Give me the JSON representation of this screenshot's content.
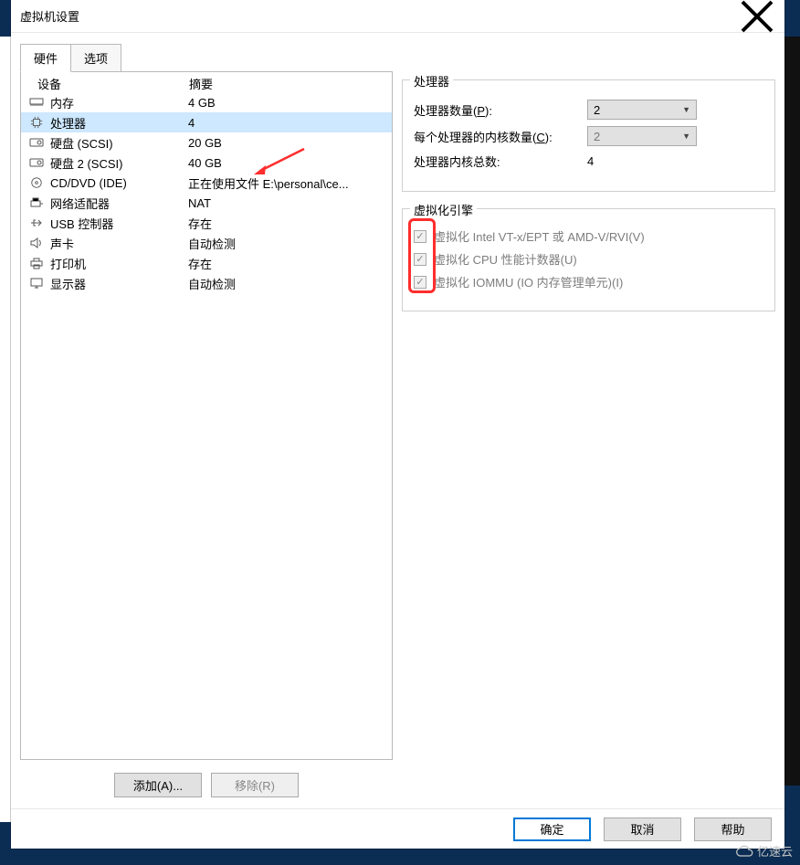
{
  "window": {
    "title": "虚拟机设置"
  },
  "tabs": {
    "hardware": "硬件",
    "options": "选项"
  },
  "device_list": {
    "col_device": "设备",
    "col_summary": "摘要",
    "rows": [
      {
        "name": "内存",
        "summary": "4 GB",
        "icon": "memory"
      },
      {
        "name": "处理器",
        "summary": "4",
        "icon": "cpu",
        "selected": true
      },
      {
        "name": "硬盘 (SCSI)",
        "summary": "20 GB",
        "icon": "disk"
      },
      {
        "name": "硬盘 2 (SCSI)",
        "summary": "40 GB",
        "icon": "disk"
      },
      {
        "name": "CD/DVD (IDE)",
        "summary": "正在使用文件 E:\\personal\\ce...",
        "icon": "cd"
      },
      {
        "name": "网络适配器",
        "summary": "NAT",
        "icon": "net"
      },
      {
        "name": "USB 控制器",
        "summary": "存在",
        "icon": "usb"
      },
      {
        "name": "声卡",
        "summary": "自动检测",
        "icon": "sound"
      },
      {
        "name": "打印机",
        "summary": "存在",
        "icon": "printer"
      },
      {
        "name": "显示器",
        "summary": "自动检测",
        "icon": "display"
      }
    ]
  },
  "buttons": {
    "add": "添加(A)...",
    "remove": "移除(R)"
  },
  "processor_group": {
    "legend": "处理器",
    "count_label_pre": "处理器数量(",
    "count_hot": "P",
    "count_label_post": "):",
    "cores_label_pre": "每个处理器的内核数量(",
    "cores_hot": "C",
    "cores_label_post": "):",
    "total_label": "处理器内核总数:",
    "count_value": "2",
    "cores_value": "2",
    "total_value": "4"
  },
  "virt_group": {
    "legend": "虚拟化引擎",
    "vt_label_pre": "虚拟化 Intel VT-x/EPT 或 AMD-V/RVI(",
    "vt_hot": "V",
    "vt_post": ")",
    "perf_label_pre": "虚拟化 CPU 性能计数器(",
    "perf_hot": "U",
    "perf_post": ")",
    "iommu_label_pre": "虚拟化 IOMMU (IO 内存管理单元)(",
    "iommu_hot": "I",
    "iommu_post": ")"
  },
  "footer": {
    "ok": "确定",
    "cancel": "取消",
    "help": "帮助"
  },
  "watermark": "亿速云"
}
